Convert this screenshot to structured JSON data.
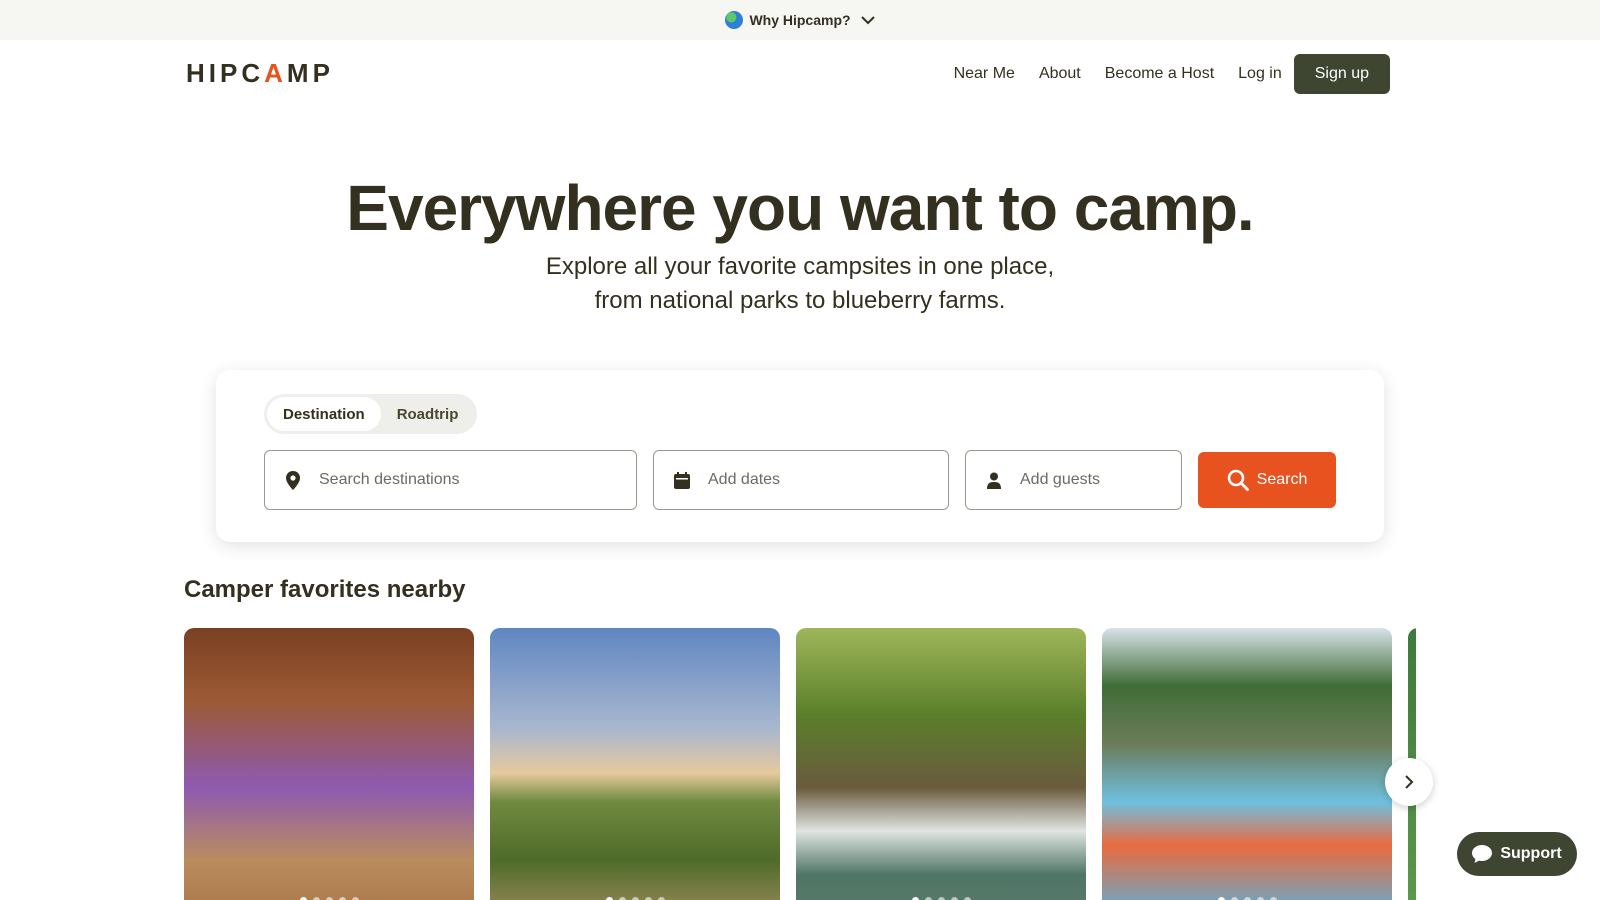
{
  "topbar": {
    "label": "Why Hipcamp?",
    "icon": "globe-icon"
  },
  "header": {
    "logo": {
      "pre": "HIPC",
      "accent": "A",
      "post": "MP"
    },
    "nav": [
      {
        "label": "Near Me"
      },
      {
        "label": "About"
      },
      {
        "label": "Become a Host"
      },
      {
        "label": "Log in"
      }
    ],
    "signup_label": "Sign up"
  },
  "hero": {
    "title": "Everywhere you want to camp.",
    "subtitle": "Explore all your favorite campsites in one place, from national parks to blueberry farms."
  },
  "search": {
    "tabs": [
      {
        "label": "Destination",
        "active": true
      },
      {
        "label": "Roadtrip",
        "active": false
      }
    ],
    "destination_placeholder": "Search destinations",
    "dates_placeholder": "Add dates",
    "guests_placeholder": "Add guests",
    "button_label": "Search"
  },
  "section": {
    "title": "Camper favorites nearby"
  },
  "support": {
    "label": "Support"
  },
  "colors": {
    "brand": "#e8521f",
    "dark": "#3e4530",
    "text": "#33301f"
  }
}
